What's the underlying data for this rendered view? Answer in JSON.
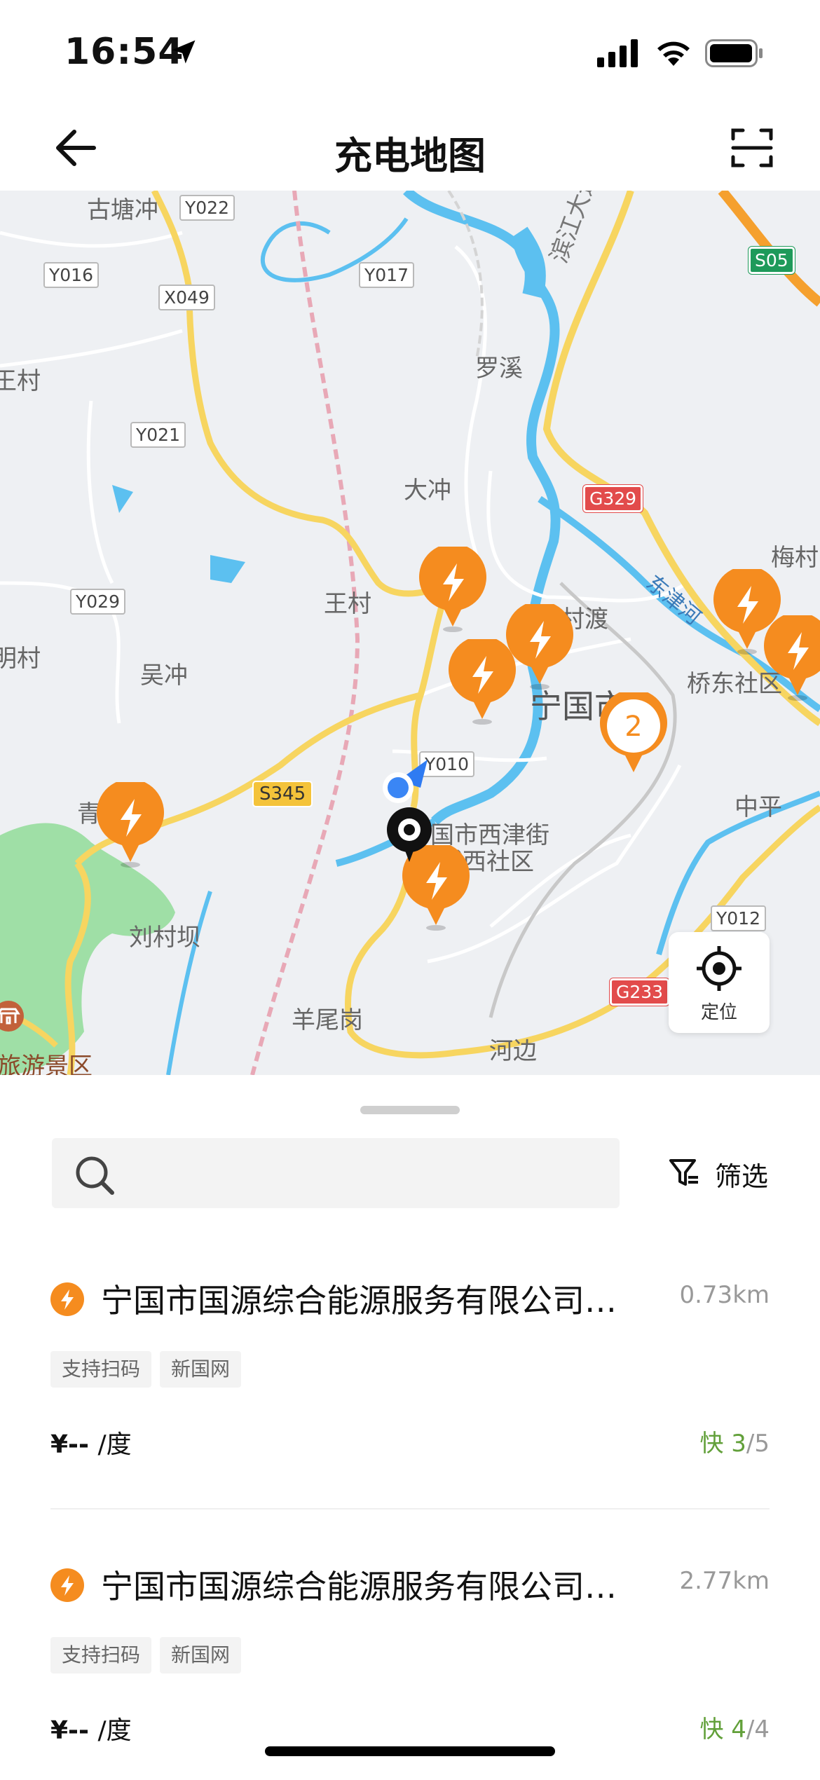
{
  "status_bar": {
    "time": "16:54"
  },
  "nav": {
    "title": "充电地图"
  },
  "map": {
    "place_labels": [
      "古塘冲",
      "王村",
      "罗溪",
      "大冲",
      "王村",
      "吴冲",
      "梅村",
      "村渡",
      "宁国市",
      "桥东社区",
      "中平",
      "刘村坝",
      "羊尾岗",
      "河边",
      "旅游景区",
      "国市西津街",
      "城西社区",
      "明村",
      "青"
    ],
    "road_labels": [
      "Y022",
      "Y016",
      "X049",
      "Y017",
      "Y021",
      "Y029",
      "Y010",
      "Y012"
    ],
    "highway_labels": [
      "G329",
      "G233"
    ],
    "expressway_label": "S05",
    "provincial_label": "S345",
    "road_name": "滨江大道",
    "river_name": "东津河",
    "cluster_count": "2",
    "locate_label": "定位"
  },
  "search": {
    "placeholder": ""
  },
  "filter": {
    "label": "筛选"
  },
  "stations": [
    {
      "name": "宁国市国源综合能源服务有限公司…",
      "distance": "0.73km",
      "tags": [
        "支持扫码",
        "新国网"
      ],
      "price": "¥-- ",
      "price_unit": "/度",
      "fast_label": "快",
      "available": "3",
      "total": "/5"
    },
    {
      "name": "宁国市国源综合能源服务有限公司…",
      "distance": "2.77km",
      "tags": [
        "支持扫码",
        "新国网"
      ],
      "price": "¥-- ",
      "price_unit": "/度",
      "fast_label": "快",
      "available": "4",
      "total": "/4"
    }
  ],
  "colors": {
    "pin_orange": "#f58c1f",
    "fast_green": "#62a03a",
    "river_blue": "#5cc0f0",
    "road_yellow": "#f7d560"
  }
}
